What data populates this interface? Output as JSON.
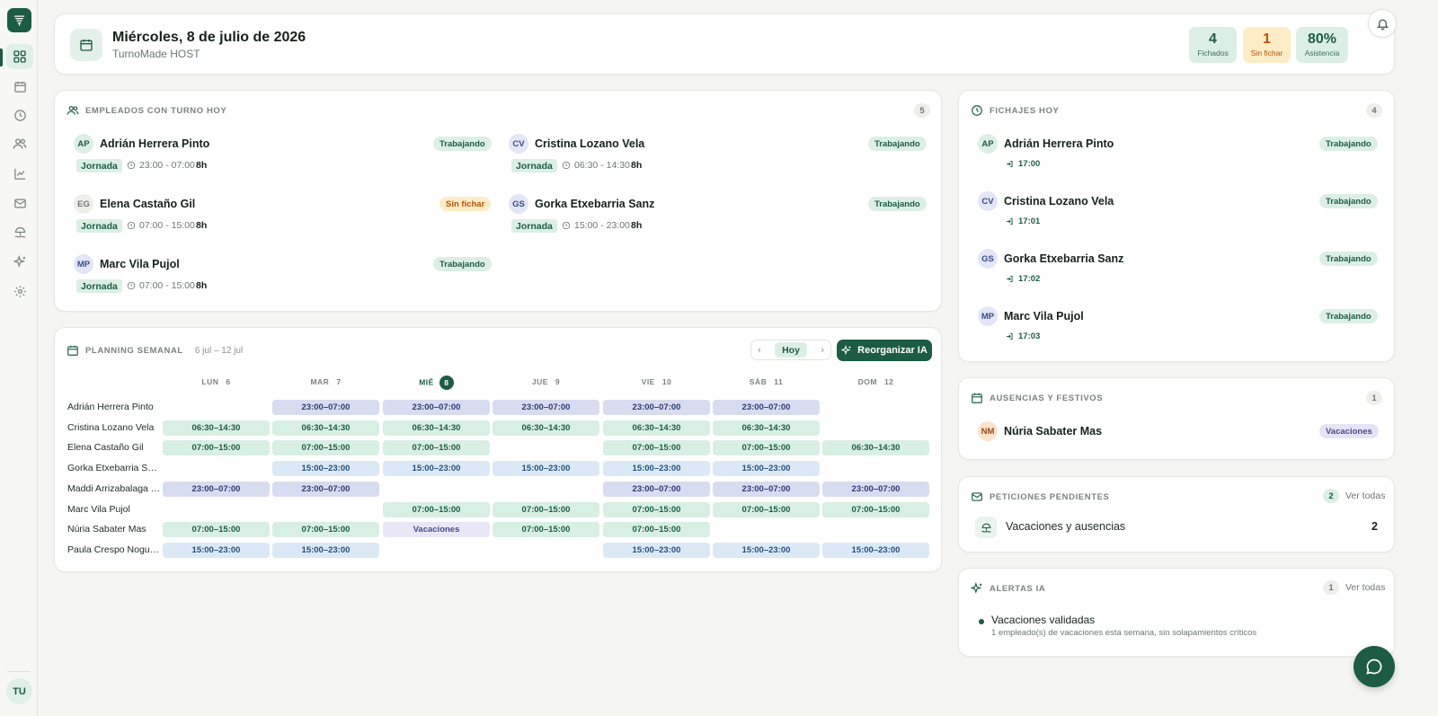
{
  "colors": {
    "brand": "#1d5c44",
    "brand_light": "#dcefe5",
    "amber": "#b45309",
    "night": "#d8dcf0"
  },
  "sidebar": {
    "items": [
      {
        "icon": "grid-icon",
        "name": "sidebar-item-dashboard",
        "active": true
      },
      {
        "icon": "calendar-icon",
        "name": "sidebar-item-calendar"
      },
      {
        "icon": "clock-icon",
        "name": "sidebar-item-fichajes"
      },
      {
        "icon": "users-icon",
        "name": "sidebar-item-employees"
      },
      {
        "icon": "chart-icon",
        "name": "sidebar-item-reports"
      },
      {
        "icon": "mail-icon",
        "name": "sidebar-item-requests"
      },
      {
        "icon": "beach-icon",
        "name": "sidebar-item-absences"
      },
      {
        "icon": "sparkles-icon",
        "name": "sidebar-item-ai"
      },
      {
        "icon": "gear-icon",
        "name": "sidebar-item-settings"
      }
    ],
    "user_initials": "TU"
  },
  "header": {
    "title": "Miércoles, 8 de julio de 2026",
    "subtitle": "TurnoMade HOST",
    "stats": [
      {
        "value": "4",
        "label": "Fichados"
      },
      {
        "value": "1",
        "label": "Sin fichar"
      },
      {
        "value": "80%",
        "label": "Asistencia"
      }
    ]
  },
  "empleados": {
    "title": "Empleados con turno hoy",
    "count": "5",
    "list": [
      {
        "initials": "AP",
        "name": "Adrián Herrera Pinto",
        "status": "Trabajando",
        "type": "Jornada",
        "time": "23:00 - 07:00",
        "hours": "8h"
      },
      {
        "initials": "CV",
        "name": "Cristina Lozano Vela",
        "status": "Trabajando",
        "type": "Jornada",
        "time": "06:30 - 14:30",
        "hours": "8h"
      },
      {
        "initials": "EG",
        "name": "Elena Castaño Gil",
        "status": "Sin fichar",
        "type": "Jornada",
        "time": "07:00 - 15:00",
        "hours": "8h"
      },
      {
        "initials": "GS",
        "name": "Gorka Etxebarria Sanz",
        "status": "Trabajando",
        "type": "Jornada",
        "time": "15:00 - 23:00",
        "hours": "8h"
      },
      {
        "initials": "MP",
        "name": "Marc Vila Pujol",
        "status": "Trabajando",
        "type": "Jornada",
        "time": "07:00 - 15:00",
        "hours": "8h"
      }
    ]
  },
  "planning": {
    "title": "Planning semanal",
    "range": "6 jul – 12 jul",
    "today_label": "Hoy",
    "prev": "‹",
    "next": "›",
    "reorganize_label": "Reorganizar IA",
    "days": [
      {
        "name": "LUN",
        "num": "6"
      },
      {
        "name": "MAR",
        "num": "7"
      },
      {
        "name": "MIÉ",
        "num": "8"
      },
      {
        "name": "JUE",
        "num": "9"
      },
      {
        "name": "VIE",
        "num": "10"
      },
      {
        "name": "SÁB",
        "num": "11"
      },
      {
        "name": "DOM",
        "num": "12"
      }
    ],
    "rows": [
      {
        "name": "Adrián Herrera Pinto",
        "cells": [
          "",
          "23:00–07:00",
          "23:00–07:00",
          "23:00–07:00",
          "23:00–07:00",
          "23:00–07:00",
          ""
        ]
      },
      {
        "name": "Cristina Lozano Vela",
        "cells": [
          "06:30–14:30",
          "06:30–14:30",
          "06:30–14:30",
          "06:30–14:30",
          "06:30–14:30",
          "06:30–14:30",
          ""
        ]
      },
      {
        "name": "Elena Castaño Gil",
        "cells": [
          "07:00–15:00",
          "07:00–15:00",
          "07:00–15:00",
          "",
          "07:00–15:00",
          "07:00–15:00",
          "06:30–14:30"
        ]
      },
      {
        "name": "Gorka Etxebarria Sa…",
        "cells": [
          "",
          "15:00–23:00",
          "15:00–23:00",
          "15:00–23:00",
          "15:00–23:00",
          "15:00–23:00",
          ""
        ]
      },
      {
        "name": "Maddi Arrizabalaga …",
        "cells": [
          "23:00–07:00",
          "23:00–07:00",
          "",
          "",
          "23:00–07:00",
          "23:00–07:00",
          "23:00–07:00"
        ]
      },
      {
        "name": "Marc Vila Pujol",
        "cells": [
          "",
          "",
          "07:00–15:00",
          "07:00–15:00",
          "07:00–15:00",
          "07:00–15:00",
          "07:00–15:00"
        ]
      },
      {
        "name": "Núria Sabater Mas",
        "cells": [
          "07:00–15:00",
          "07:00–15:00",
          "Vacaciones",
          "07:00–15:00",
          "07:00–15:00",
          "",
          ""
        ]
      },
      {
        "name": "Paula Crespo Nogu…",
        "cells": [
          "15:00–23:00",
          "15:00–23:00",
          "",
          "",
          "15:00–23:00",
          "15:00–23:00",
          "15:00–23:00"
        ]
      }
    ]
  },
  "fichajes": {
    "title": "Fichajes hoy",
    "count": "4",
    "list": [
      {
        "initials": "AP",
        "name": "Adrián Herrera Pinto",
        "status": "Trabajando",
        "time": "17:00"
      },
      {
        "initials": "CV",
        "name": "Cristina Lozano Vela",
        "status": "Trabajando",
        "time": "17:01"
      },
      {
        "initials": "GS",
        "name": "Gorka Etxebarria Sanz",
        "status": "Trabajando",
        "time": "17:02"
      },
      {
        "initials": "MP",
        "name": "Marc Vila Pujol",
        "status": "Trabajando",
        "time": "17:03"
      }
    ]
  },
  "ausencias": {
    "title": "Ausencias y festivos",
    "count": "1",
    "list": [
      {
        "initials": "NM",
        "name": "Núria Sabater Mas",
        "status": "Vacaciones"
      }
    ]
  },
  "peticiones": {
    "title": "Peticiones pendientes",
    "count": "2",
    "see_all": "Ver todas",
    "item_label": "Vacaciones y ausencias",
    "item_count": "2"
  },
  "alertas": {
    "title": "Alertas IA",
    "count": "1",
    "see_all": "Ver todas",
    "item_title": "Vacaciones validadas",
    "item_desc": "1 empleado(s) de vacaciones esta semana, sin solapamientos críticos"
  }
}
